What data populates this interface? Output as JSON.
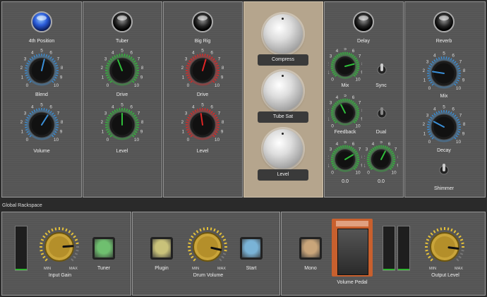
{
  "rack": {
    "panels": [
      {
        "id": "fourth-position",
        "lamp_label": "4th Position",
        "lamp_on": true,
        "knob1_label": "Blend",
        "knob2_label": "Volume",
        "ring_color": "#3a8fd8"
      },
      {
        "id": "tuber",
        "lamp_label": "Tuber",
        "lamp_on": false,
        "knob1_label": "Drive",
        "knob2_label": "Level",
        "ring_color": "#2fbf3a"
      },
      {
        "id": "big-rig",
        "lamp_label": "Big Rig",
        "lamp_on": false,
        "knob1_label": "Drive",
        "knob2_label": "Level",
        "ring_color": "#e02525"
      }
    ],
    "scale_labels": [
      "0",
      "1",
      "2",
      "3",
      "4",
      "5",
      "6",
      "7",
      "8",
      "9",
      "10"
    ],
    "compressor": {
      "buttons": [
        "Compress",
        "Tube Sat",
        "Level"
      ]
    },
    "delay": {
      "lamp_label": "Delay",
      "mix_label": "Mix",
      "sync_label": "Sync",
      "feedback_label": "Feedback",
      "dual_label": "Dual",
      "readout_left": "0.0",
      "readout_right": "0.0",
      "ring_color": "#2fbf3a"
    },
    "reverb": {
      "lamp_label": "Reverb",
      "mix_label": "Mix",
      "decay_label": "Decay",
      "shimmer_label": "Shimmer",
      "ring_color": "#3a8fd8"
    }
  },
  "global": {
    "title": "Global Rackspace",
    "input_gain_label": "Input Gain",
    "tuner_label": "Tuner",
    "plugin_label": "Plugin",
    "drum_volume_label": "Drum Volume",
    "start_label": "Start",
    "mono_label": "Mono",
    "volume_pedal_label": "Volume Pedal",
    "output_level_label": "Output Level",
    "min_label": "MIN",
    "max_label": "MAX"
  },
  "colors": {
    "tuner_pad": "#6fbf6f",
    "plugin_pad": "#c9c27a",
    "start_pad": "#7ab3d6",
    "mono_pad": "#c9a57a",
    "gold": "#c9a43a"
  }
}
